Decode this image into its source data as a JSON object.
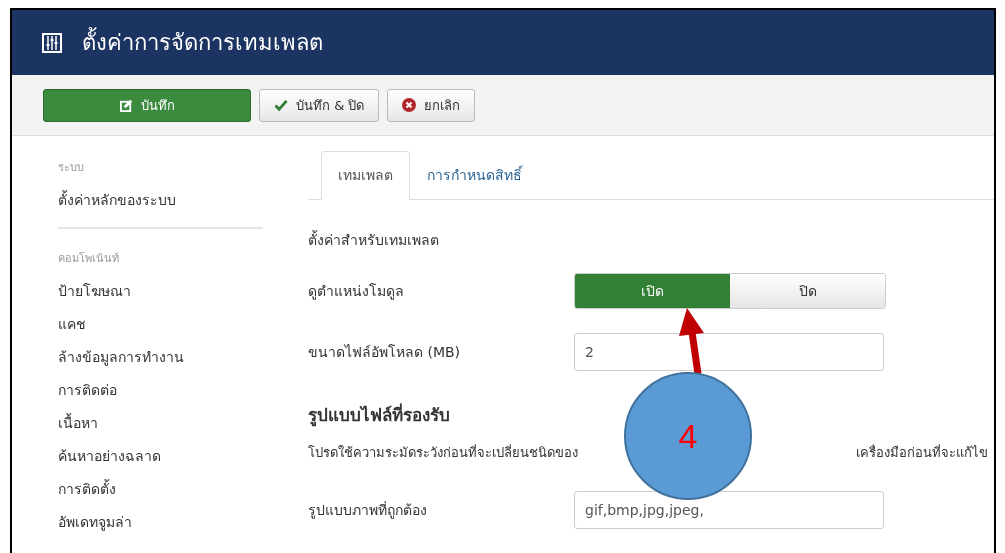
{
  "header": {
    "title": "ตั้งค่าการจัดการเทมเพลต"
  },
  "toolbar": [
    {
      "kind": "save",
      "label": "บันทึก"
    },
    {
      "kind": "save_close",
      "label": "บันทึก & ปิด"
    },
    {
      "kind": "cancel",
      "label": "ยกเลิก"
    }
  ],
  "sidebar": [
    {
      "heading": "ระบบ",
      "items": [
        "ตั้งค่าหลักของระบบ"
      ]
    },
    {
      "heading": "คอมโพเน้นท์",
      "items": [
        "ป้ายโฆษณา",
        "แคช",
        "ล้างข้อมูลการทำงาน",
        "การติดต่อ",
        "เนื้อหา",
        "ค้นหาอย่างฉลาด",
        "การติดตั้ง",
        "อัพเดทจูมล่า"
      ]
    }
  ],
  "tabs": [
    {
      "label": "เทมเพลต",
      "selected": true
    },
    {
      "label": "การกำหนดสิทธิ์",
      "selected": false
    }
  ],
  "form": [
    {
      "kind": "caption",
      "text": "ตั้งค่าสำหรับเทมเพลต"
    },
    {
      "kind": "toggle",
      "label": "ดูตำแหน่งโมดูล",
      "options": [
        {
          "label": "เปิด",
          "selected": true
        },
        {
          "label": "ปิด",
          "selected": false
        }
      ]
    },
    {
      "kind": "input",
      "label": "ขนาดไฟล์อัพโหลด (MB)",
      "value": "2"
    },
    {
      "kind": "heading",
      "text": "รูปแบบไฟล์ที่รองรับ"
    },
    {
      "kind": "notice",
      "parts": [
        "โปรดใช้ความระมัดระวังก่อนที่จะเปลี่ยนชนิดของ",
        "เครื่องมือก่อนที่จะแก้ไข"
      ]
    },
    {
      "kind": "input",
      "label": "รูปแบบภาพที่ถูกต้อง",
      "value": "gif,bmp,jpg,jpeg,"
    }
  ],
  "annotation": {
    "label": "4"
  }
}
